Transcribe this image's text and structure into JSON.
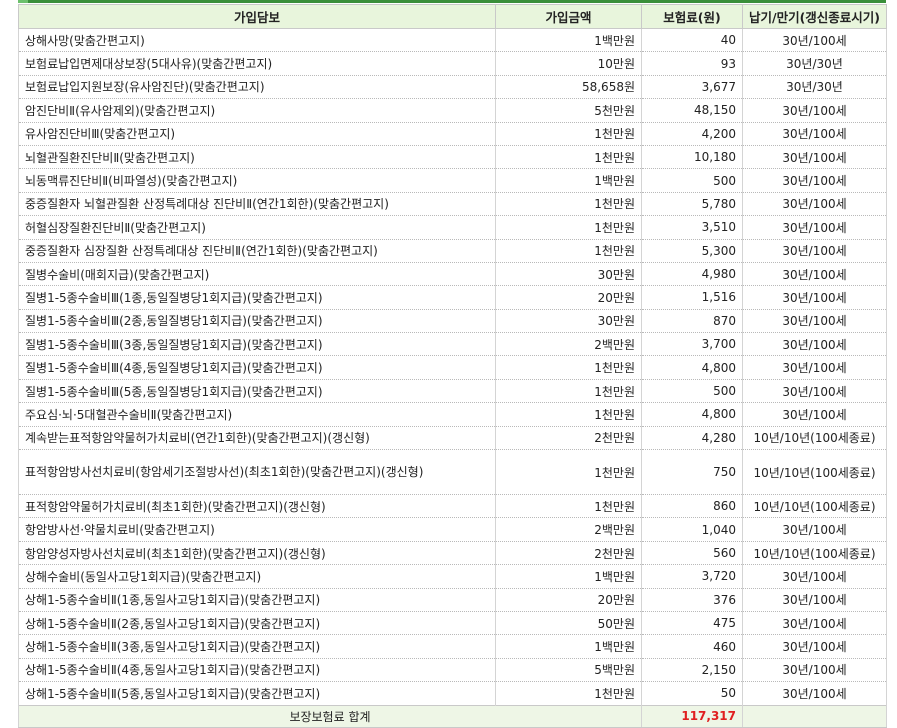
{
  "header": {
    "coverage": "가입담보",
    "amount": "가입금액",
    "premium": "보험료(원)",
    "term": "납기/만기(갱신종료시기)"
  },
  "rows": [
    {
      "name": "상해사망(맞춤간편고지)",
      "amount": "1백만원",
      "premium": "40",
      "term": "30년/100세"
    },
    {
      "name": "보험료납입면제대상보장(5대사유)(맞춤간편고지)",
      "amount": "10만원",
      "premium": "93",
      "term": "30년/30년"
    },
    {
      "name": "보험료납입지원보장(유사암진단)(맞춤간편고지)",
      "amount": "58,658원",
      "premium": "3,677",
      "term": "30년/30년"
    },
    {
      "name": "암진단비Ⅱ(유사암제외)(맞춤간편고지)",
      "amount": "5천만원",
      "premium": "48,150",
      "term": "30년/100세"
    },
    {
      "name": "유사암진단비Ⅲ(맞춤간편고지)",
      "amount": "1천만원",
      "premium": "4,200",
      "term": "30년/100세"
    },
    {
      "name": "뇌혈관질환진단비Ⅱ(맞춤간편고지)",
      "amount": "1천만원",
      "premium": "10,180",
      "term": "30년/100세"
    },
    {
      "name": "뇌동맥류진단비Ⅱ(비파열성)(맞춤간편고지)",
      "amount": "1백만원",
      "premium": "500",
      "term": "30년/100세"
    },
    {
      "name": "중증질환자 뇌혈관질환 산정특례대상 진단비Ⅱ(연간1회한)(맞춤간편고지)",
      "amount": "1천만원",
      "premium": "5,780",
      "term": "30년/100세"
    },
    {
      "name": "허혈심장질환진단비Ⅱ(맞춤간편고지)",
      "amount": "1천만원",
      "premium": "3,510",
      "term": "30년/100세"
    },
    {
      "name": "중증질환자 심장질환 산정특례대상 진단비Ⅱ(연간1회한)(맞춤간편고지)",
      "amount": "1천만원",
      "premium": "5,300",
      "term": "30년/100세"
    },
    {
      "name": "질병수술비(매회지급)(맞춤간편고지)",
      "amount": "30만원",
      "premium": "4,980",
      "term": "30년/100세"
    },
    {
      "name": "질병1-5종수술비Ⅲ(1종,동일질병당1회지급)(맞춤간편고지)",
      "amount": "20만원",
      "premium": "1,516",
      "term": "30년/100세"
    },
    {
      "name": "질병1-5종수술비Ⅲ(2종,동일질병당1회지급)(맞춤간편고지)",
      "amount": "30만원",
      "premium": "870",
      "term": "30년/100세"
    },
    {
      "name": "질병1-5종수술비Ⅲ(3종,동일질병당1회지급)(맞춤간편고지)",
      "amount": "2백만원",
      "premium": "3,700",
      "term": "30년/100세"
    },
    {
      "name": "질병1-5종수술비Ⅲ(4종,동일질병당1회지급)(맞춤간편고지)",
      "amount": "1천만원",
      "premium": "4,800",
      "term": "30년/100세"
    },
    {
      "name": "질병1-5종수술비Ⅲ(5종,동일질병당1회지급)(맞춤간편고지)",
      "amount": "1천만원",
      "premium": "500",
      "term": "30년/100세"
    },
    {
      "name": "주요심·뇌·5대혈관수술비Ⅱ(맞춤간편고지)",
      "amount": "1천만원",
      "premium": "4,800",
      "term": "30년/100세"
    },
    {
      "name": "계속받는표적항암약물허가치료비(연간1회한)(맞춤간편고지)(갱신형)",
      "amount": "2천만원",
      "premium": "4,280",
      "term": "10년/10년(100세종료)"
    },
    {
      "name": "표적항암방사선치료비(항암세기조절방사선)(최초1회한)(맞춤간편고지)(갱신형)",
      "amount": "1천만원",
      "premium": "750",
      "term": "10년/10년(100세종료)",
      "tall": true
    },
    {
      "name": "표적항암약물허가치료비(최초1회한)(맞춤간편고지)(갱신형)",
      "amount": "1천만원",
      "premium": "860",
      "term": "10년/10년(100세종료)"
    },
    {
      "name": "항암방사선·약물치료비(맞춤간편고지)",
      "amount": "2백만원",
      "premium": "1,040",
      "term": "30년/100세"
    },
    {
      "name": "항암양성자방사선치료비(최초1회한)(맞춤간편고지)(갱신형)",
      "amount": "2천만원",
      "premium": "560",
      "term": "10년/10년(100세종료)"
    },
    {
      "name": "상해수술비(동일사고당1회지급)(맞춤간편고지)",
      "amount": "1백만원",
      "premium": "3,720",
      "term": "30년/100세"
    },
    {
      "name": "상해1-5종수술비Ⅱ(1종,동일사고당1회지급)(맞춤간편고지)",
      "amount": "20만원",
      "premium": "376",
      "term": "30년/100세"
    },
    {
      "name": "상해1-5종수술비Ⅱ(2종,동일사고당1회지급)(맞춤간편고지)",
      "amount": "50만원",
      "premium": "475",
      "term": "30년/100세"
    },
    {
      "name": "상해1-5종수술비Ⅱ(3종,동일사고당1회지급)(맞춤간편고지)",
      "amount": "1백만원",
      "premium": "460",
      "term": "30년/100세"
    },
    {
      "name": "상해1-5종수술비Ⅱ(4종,동일사고당1회지급)(맞춤간편고지)",
      "amount": "5백만원",
      "premium": "2,150",
      "term": "30년/100세"
    },
    {
      "name": "상해1-5종수술비Ⅱ(5종,동일사고당1회지급)(맞춤간편고지)",
      "amount": "1천만원",
      "premium": "50",
      "term": "30년/100세"
    }
  ],
  "total": {
    "label": "보장보험료 합계",
    "value": "117,317"
  },
  "colors": {
    "header_bg": "#e8f5dc",
    "accent_line": "#3a8f3a",
    "total_text": "#e02020"
  }
}
